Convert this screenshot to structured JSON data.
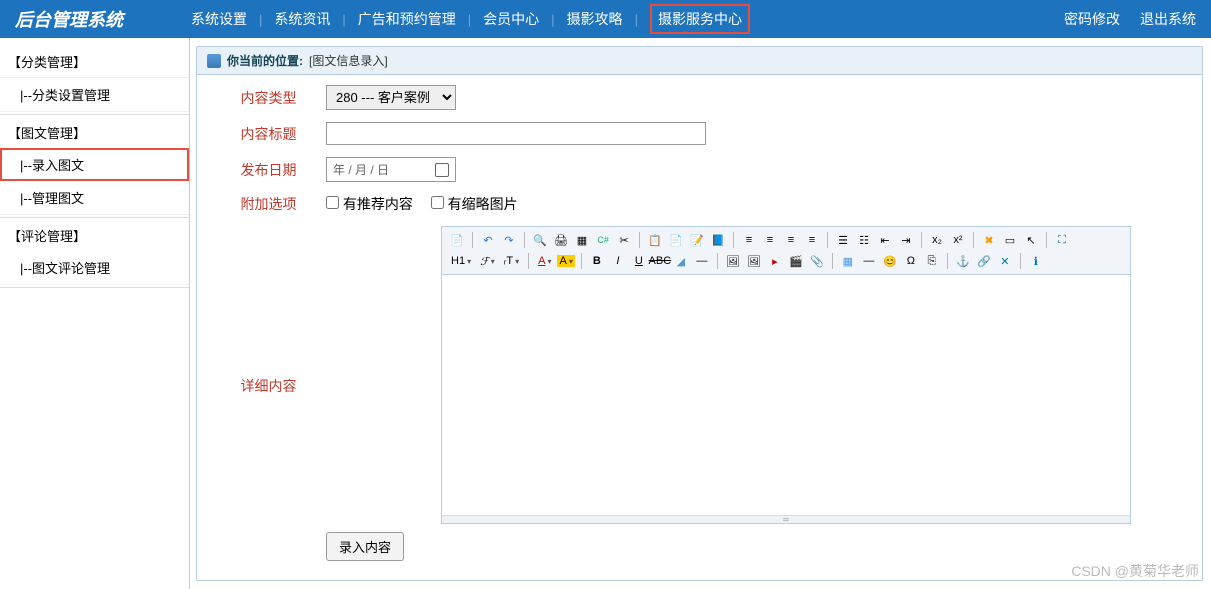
{
  "header": {
    "logo": "后台管理系统",
    "nav": [
      "系统设置",
      "系统资讯",
      "广告和预约管理",
      "会员中心",
      "摄影攻略",
      "摄影服务中心"
    ],
    "nav_highlight_index": 5,
    "right": {
      "pwd": "密码修改",
      "logout": "退出系统"
    }
  },
  "sidebar": {
    "group1": "【分类管理】",
    "item1": "|--分类设置管理",
    "group2": "【图文管理】",
    "item2": "|--录入图文",
    "item3": "|--管理图文",
    "group3": "【评论管理】",
    "item4": "|--图文评论管理"
  },
  "crumb": {
    "prefix": "你当前的位置:",
    "loc": "[图文信息录入]"
  },
  "form": {
    "labels": {
      "type": "内容类型",
      "title": "内容标题",
      "date": "发布日期",
      "extra": "附加选项",
      "detail": "详细内容"
    },
    "type_select": "280 --- 客户案例",
    "date_placeholder": "年 / 月 / 日",
    "opt_recommend": "有推荐内容",
    "opt_thumb": "有缩略图片",
    "submit": "录入内容"
  },
  "watermark": "CSDN @黄菊华老师"
}
